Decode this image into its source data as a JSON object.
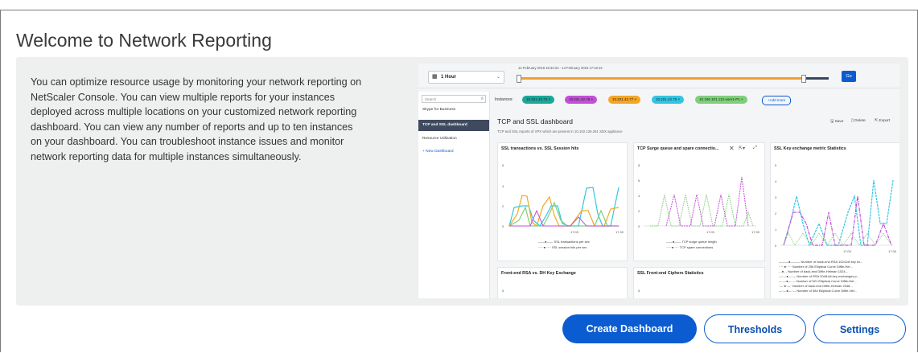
{
  "page": {
    "title": "Welcome to Network Reporting",
    "description": "You can optimize resource usage by monitoring your network reporting on NetScaler Console. You can view multiple reports for your instances deployed across multiple locations on your customized network reporting dashboard. You can view any number of reports and up to ten instances on your dashboard. You can troubleshoot instance issues and monitor network reporting data for multiple instances simultaneously."
  },
  "preview": {
    "time_select": "1 Hour",
    "time_range": "14 February 2018 16:32:22 - 14 February 2018 17:32:22",
    "go_label": "Go",
    "search_placeholder": "Search",
    "sidebar": {
      "items": [
        {
          "label": "Skype for Business"
        },
        {
          "label": "TCP and SSL dashboard"
        },
        {
          "label": "Resource Utilization"
        },
        {
          "label": "+ New Dashboard"
        }
      ]
    },
    "instances_label": "Instances:",
    "instances": [
      {
        "label": "10.221.42.74",
        "color": "#1aa89a"
      },
      {
        "label": "10.221.42.76",
        "color": "#c34fd8"
      },
      {
        "label": "10.221.42.77",
        "color": "#f5a623"
      },
      {
        "label": "10.221.42.75",
        "color": "#30c6e3"
      },
      {
        "label": "10.106.101.112-user1-P1",
        "color": "#7ed07a"
      }
    ],
    "add_more_label": "+Add more",
    "dashboard_title": "TCP and SSL dashboard",
    "dashboard_subtitle": "TCP and SSL reports of VPX which are present in 10.102.126.251 SDX appliance",
    "save_label": "Save",
    "delete_label": "Delete",
    "export_label": "Export",
    "cards": [
      {
        "title": "SSL transactions vs. SSL Session hits",
        "y_ticks": [
          "6",
          "4",
          "2",
          "0"
        ],
        "x_ticks": [
          "17:00",
          "17:30"
        ],
        "legend": [
          "SSL transactions per sec",
          "SSL session hits per sec"
        ]
      },
      {
        "title": "TCP Surge queue and spare connectio...",
        "y_ticks": [
          "8",
          "6",
          "4",
          "2",
          "0"
        ],
        "x_ticks": [
          "17:00",
          "17:30"
        ],
        "legend": [
          "TCP surge queue length",
          "TCP spare connections"
        ]
      },
      {
        "title": "SSL Key exchange metric Statistics",
        "y_ticks": [
          "5",
          "4",
          "3",
          "2",
          "1",
          "0"
        ],
        "x_ticks": [
          "17:00",
          "17:30"
        ],
        "legend": [
          "Number of back-end RSA 1024-bit key ex...",
          "Number of 256 Elliptical Curve Diffie-Hel...",
          "Number of back-end Diffie-Helman 1024...",
          "Number of RSA 2048-bit key exchanges p...",
          "Number of 521 Elliptical Curve Diffie-Hel...",
          "Number of back-end Diffie-Helman 2048...",
          "Number of 384 Elliptical Curve Diffie-Hel..."
        ]
      },
      {
        "title": "Front-end RSA vs. DH Key Exchange",
        "y_ticks": [
          "5"
        ]
      },
      {
        "title": "SSL Front-end Ciphers Statistics",
        "y_ticks": [
          "5"
        ]
      }
    ]
  },
  "actions": {
    "create_dashboard": "Create Dashboard",
    "thresholds": "Thresholds",
    "settings": "Settings"
  },
  "colors": {
    "primary": "#0b5cd1",
    "panel_bg": "#eef0f0",
    "nav_active": "#3f4a5e"
  }
}
